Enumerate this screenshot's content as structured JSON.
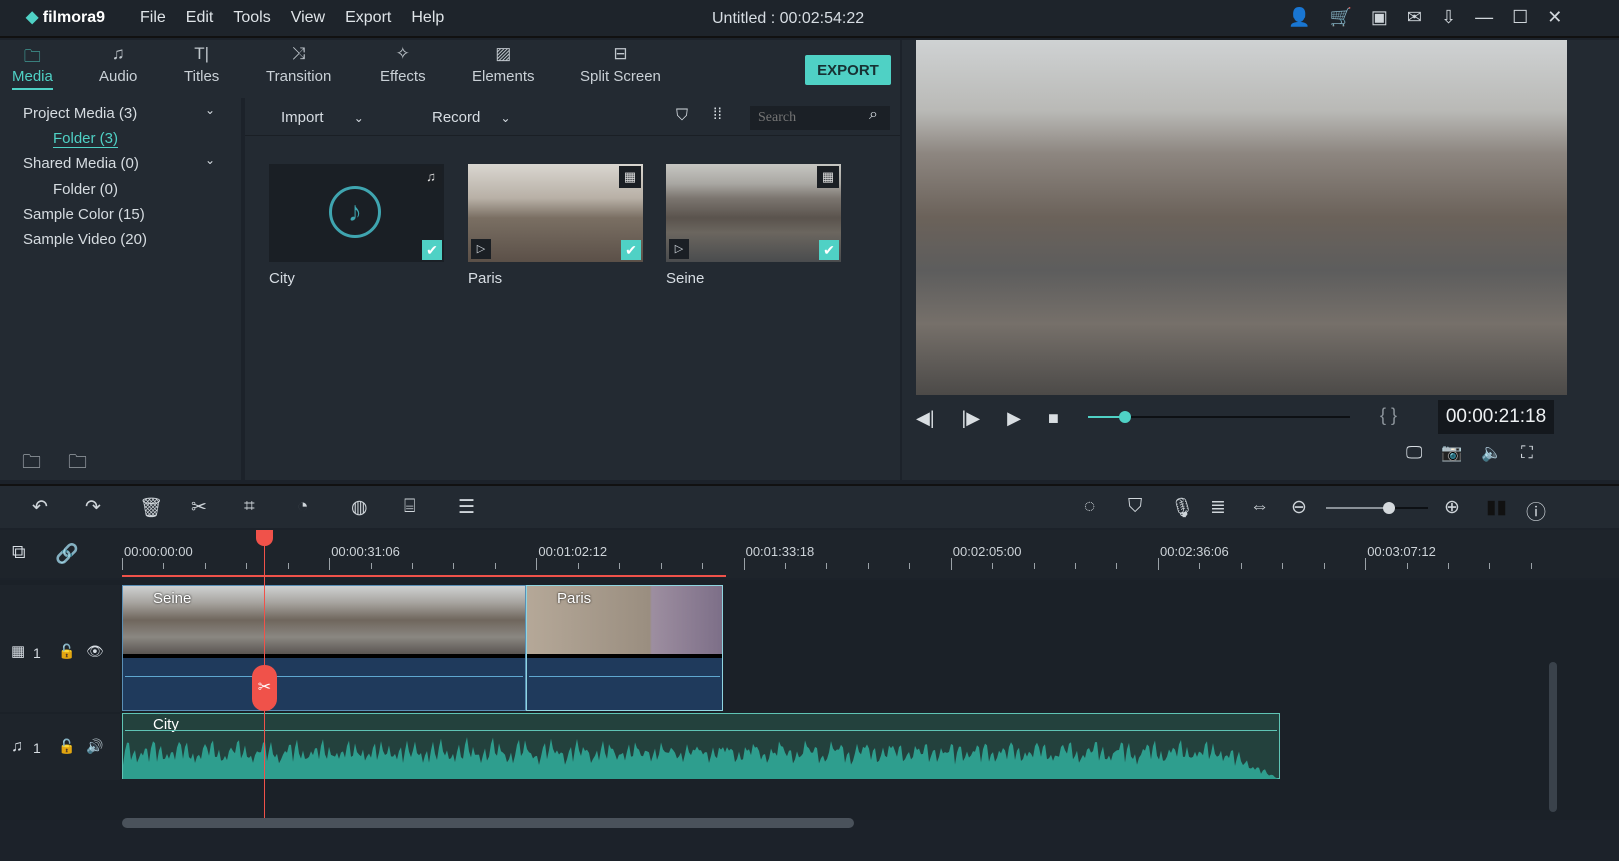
{
  "app": {
    "logo": "filmora9",
    "menu": [
      "File",
      "Edit",
      "Tools",
      "View",
      "Export",
      "Help"
    ],
    "title": "Untitled : 00:02:54:22",
    "window_icons": [
      "user-icon",
      "cart-icon",
      "save-icon",
      "mail-icon",
      "download-icon",
      "minimize-icon",
      "maximize-icon",
      "close-icon"
    ]
  },
  "tabs": [
    {
      "label": "Media",
      "icon": "folder-icon",
      "active": true
    },
    {
      "label": "Audio",
      "icon": "music-note-icon"
    },
    {
      "label": "Titles",
      "icon": "text-icon"
    },
    {
      "label": "Transition",
      "icon": "transition-icon"
    },
    {
      "label": "Effects",
      "icon": "effects-icon"
    },
    {
      "label": "Elements",
      "icon": "image-icon"
    },
    {
      "label": "Split Screen",
      "icon": "split-screen-icon"
    }
  ],
  "export_label": "EXPORT",
  "sidebar": {
    "items": [
      "Project Media (3)",
      "Folder (3)",
      "Shared Media (0)",
      "Folder (0)",
      "Sample Color (15)",
      "Sample Video (20)"
    ]
  },
  "media": {
    "import": "Import",
    "record": "Record",
    "search_placeholder": "Search",
    "items": [
      {
        "name": "City",
        "type": "audio"
      },
      {
        "name": "Paris",
        "type": "video"
      },
      {
        "name": "Seine",
        "type": "video"
      }
    ]
  },
  "player": {
    "timecode": "00:00:21:18",
    "progress": 0.14,
    "brackets": "{ }"
  },
  "timeline": {
    "ticks": [
      "00:00:00:00",
      "00:00:31:06",
      "00:01:02:12",
      "00:01:33:18",
      "00:02:05:00",
      "00:02:36:06",
      "00:03:07:12"
    ],
    "video_track": "1",
    "audio_track": "1",
    "clips": [
      "Seine",
      "Paris"
    ],
    "audio_clip": "City",
    "zoom": 0.62
  },
  "colors": {
    "accent": "#4fd1c5",
    "playhead": "#f0524a",
    "video_clip": "#1f3a5c",
    "audio_clip": "#2e9e8e"
  }
}
